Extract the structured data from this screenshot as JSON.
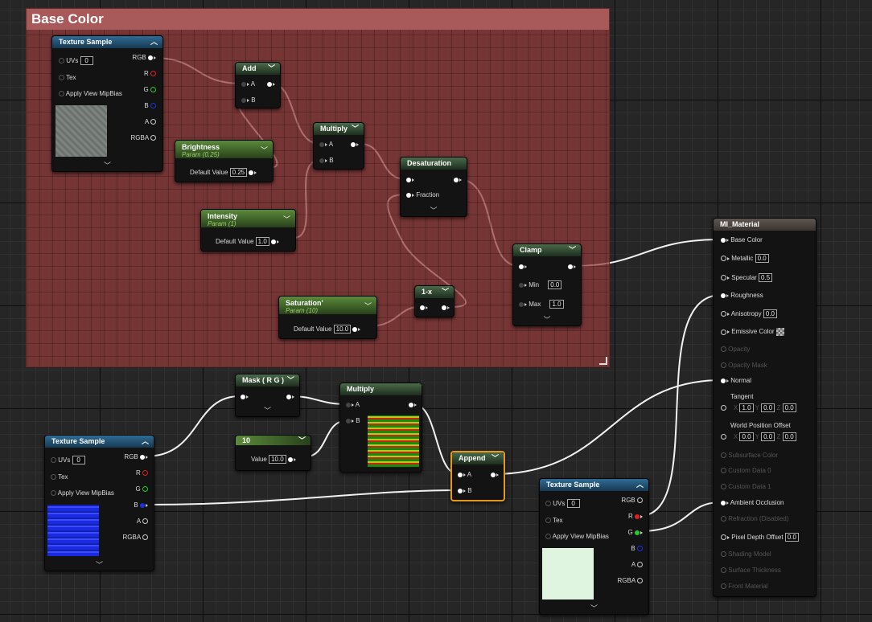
{
  "comment": {
    "title": "Base Color"
  },
  "tex1": {
    "title": "Texture Sample",
    "uvs": "UVs",
    "uvs_value": "0",
    "tex": "Tex",
    "mip": "Apply View MipBias",
    "outputs": [
      "RGB",
      "R",
      "G",
      "B",
      "A",
      "RGBA"
    ]
  },
  "add": {
    "title": "Add",
    "a": "A",
    "b": "B"
  },
  "brightness": {
    "title": "Brightness",
    "sub": "Param (0.25)",
    "label": "Default Value",
    "value": "0.25"
  },
  "intensity": {
    "title": "Intensity",
    "sub": "Param (1)",
    "label": "Default Value",
    "value": "1.0"
  },
  "multiply1": {
    "title": "Multiply",
    "a": "A",
    "b": "B"
  },
  "desat": {
    "title": "Desaturation",
    "fraction": "Fraction"
  },
  "clamp": {
    "title": "Clamp",
    "min": "Min",
    "min_value": "0.0",
    "max": "Max",
    "max_value": "1.0"
  },
  "one_minus": {
    "title": "1-x"
  },
  "saturation": {
    "title": "Saturation'",
    "sub": "Param (10)",
    "label": "Default Value",
    "value": "10.0"
  },
  "mask": {
    "title": "Mask ( R G )"
  },
  "multiply2": {
    "title": "Multiply",
    "a": "A",
    "b": "B"
  },
  "const10": {
    "title": "10",
    "label": "Value",
    "value": "10.0"
  },
  "tex2": {
    "title": "Texture Sample",
    "uvs": "UVs",
    "uvs_value": "0",
    "tex": "Tex",
    "mip": "Apply View MipBias",
    "outputs": [
      "RGB",
      "R",
      "G",
      "B",
      "A",
      "RGBA"
    ]
  },
  "append": {
    "title": "Append",
    "a": "A",
    "b": "B"
  },
  "tex3": {
    "title": "Texture Sample",
    "uvs": "UVs",
    "uvs_value": "0",
    "tex": "Tex",
    "mip": "Apply View MipBias",
    "outputs": [
      "RGB",
      "R",
      "G",
      "B",
      "A",
      "RGBA"
    ]
  },
  "material": {
    "title": "MI_Material",
    "base_color": "Base Color",
    "metallic": "Metallic",
    "metallic_value": "0.0",
    "specular": "Specular",
    "specular_value": "0.5",
    "roughness": "Roughness",
    "anisotropy": "Anisotropy",
    "anisotropy_value": "0.0",
    "emissive": "Emissive Color",
    "opacity": "Opacity",
    "opacity_mask": "Opacity Mask",
    "normal": "Normal",
    "tangent": "Tangent",
    "tangent_x": "1.0",
    "tangent_y": "0.0",
    "tangent_z": "0.0",
    "wpo": "World Position Offset",
    "wpo_x": "0.0",
    "wpo_y": "0.0",
    "wpo_z": "0.0",
    "axis_x": "X",
    "axis_y": "Y",
    "axis_z": "Z",
    "subsurface": "Subsurface Color",
    "custom0": "Custom Data 0",
    "custom1": "Custom Data 1",
    "ao": "Ambient Occlusion",
    "refraction": "Refraction (Disabled)",
    "pdo": "Pixel Depth Offset",
    "pdo_value": "0.0",
    "shading_model": "Shading Model",
    "surface_thickness": "Surface Thickness",
    "front_material": "Front Material"
  },
  "colors": {
    "pin_r": "#e02020",
    "pin_g": "#20d020",
    "pin_b": "#2030e0",
    "selection": "#e79a1a",
    "comment": "#a85a5a"
  },
  "icons": {
    "expand": "chevron-down-icon",
    "collapse": "chevron-up-icon"
  }
}
